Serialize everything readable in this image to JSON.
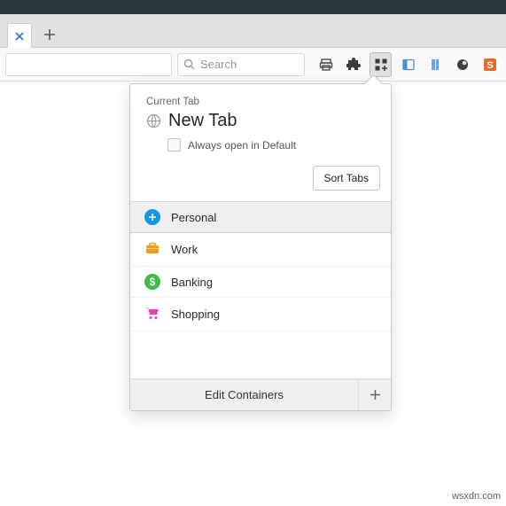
{
  "search": {
    "placeholder": "Search"
  },
  "panel": {
    "current_tab_label": "Current Tab",
    "tab_name": "New Tab",
    "always_open_label": "Always open in Default",
    "sort_label": "Sort Tabs",
    "containers": [
      {
        "label": "Personal"
      },
      {
        "label": "Work"
      },
      {
        "label": "Banking"
      },
      {
        "label": "Shopping"
      }
    ],
    "footer": {
      "edit_label": "Edit Containers"
    }
  },
  "attribution": "wsxdn.com"
}
